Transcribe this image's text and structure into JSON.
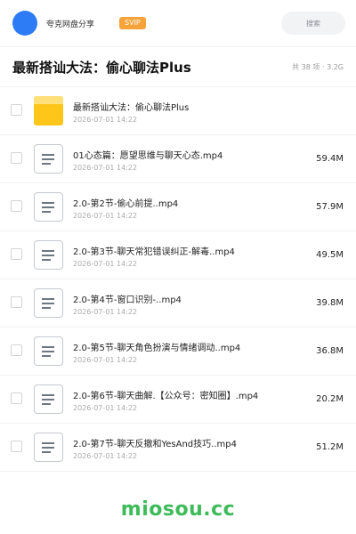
{
  "header": {
    "app_name": "夸克网盘分享",
    "badge": "SVIP",
    "search_placeholder": "搜索",
    "avatar_color": "#2d7cf6"
  },
  "folder": {
    "title": "最新搭讪大法：偷心聊法Plus",
    "meta": "共 38 项 · 3.2G"
  },
  "files": [
    {
      "name": "最新搭讪大法：偷心聊法Plus",
      "date": "2026-07-01 14:22",
      "size": "",
      "icon": "folder-icon"
    },
    {
      "name": "01心态篇：愿望思维与聊天心态.mp4",
      "date": "2026-07-01 14:22",
      "size": "59.4M",
      "icon": "document-icon"
    },
    {
      "name": "2.0-第2节-偷心前提..mp4",
      "date": "2026-07-01 14:22",
      "size": "57.9M",
      "icon": "document-icon"
    },
    {
      "name": "2.0-第3节-聊天常犯错误纠正-解毒..mp4",
      "date": "2026-07-01 14:22",
      "size": "49.5M",
      "icon": "document-icon"
    },
    {
      "name": "2.0-第4节-窗口识别-..mp4",
      "date": "2026-07-01 14:22",
      "size": "39.8M",
      "icon": "document-icon"
    },
    {
      "name": "2.0-第5节-聊天角色扮演与情绪调动..mp4",
      "date": "2026-07-01 14:22",
      "size": "36.8M",
      "icon": "document-icon"
    },
    {
      "name": "2.0-第6节-聊天曲解.【公众号：密知圈】.mp4",
      "date": "2026-07-01 14:22",
      "size": "20.2M",
      "icon": "document-icon"
    },
    {
      "name": "2.0-第7节-聊天反撤和YesAnd技巧..mp4",
      "date": "2026-07-01 14:22",
      "size": "51.2M",
      "icon": "document-icon"
    }
  ],
  "watermark": "miosou.cc",
  "colors": {
    "accent": "#2d7cf6",
    "badge": "#f6a33a",
    "folder": "#ffc61a",
    "watermark": "#3dbb5a"
  }
}
